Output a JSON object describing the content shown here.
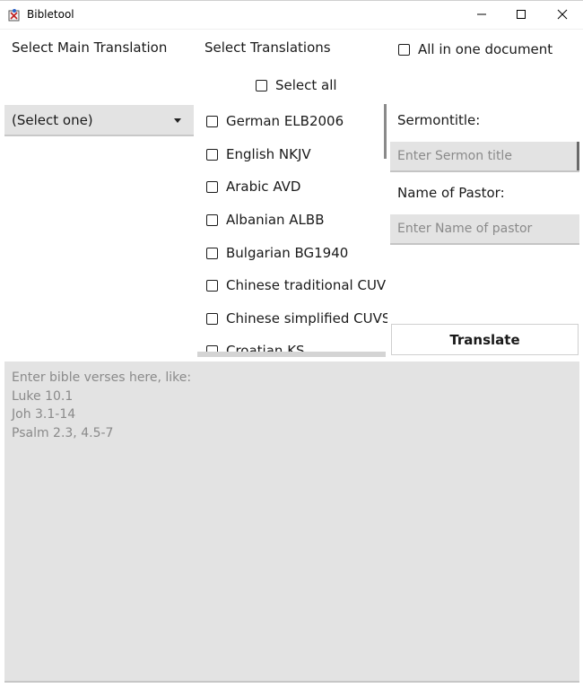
{
  "window": {
    "title": "Bibletool",
    "minimize_glyph": "—",
    "maximize_glyph": "☐",
    "close_glyph": "✕"
  },
  "main_translation": {
    "label": "Select Main Translation",
    "selected": "(Select one)"
  },
  "translations": {
    "label": "Select Translations",
    "select_all_label": "Select all",
    "items": [
      "German ELB2006",
      "English NKJV",
      "Arabic AVD",
      "Albanian ALBB",
      "Bulgarian BG1940",
      "Chinese traditional CUV",
      "Chinese simplified CUVS",
      "Croatian KS"
    ]
  },
  "options": {
    "all_in_one_label": "All in one document"
  },
  "sermon": {
    "title_label": "Sermontitle:",
    "title_placeholder": "Enter Sermon title",
    "pastor_label": "Name of Pastor:",
    "pastor_placeholder": "Enter Name of pastor"
  },
  "actions": {
    "translate_label": "Translate"
  },
  "verses": {
    "placeholder_lines": [
      "Enter bible verses here, like:",
      "Luke 10.1",
      "Joh 3.1-14",
      "Psalm 2.3, 4.5-7"
    ]
  },
  "icons": {
    "app": "app-icon",
    "dropdown": "chevron-down-icon"
  }
}
